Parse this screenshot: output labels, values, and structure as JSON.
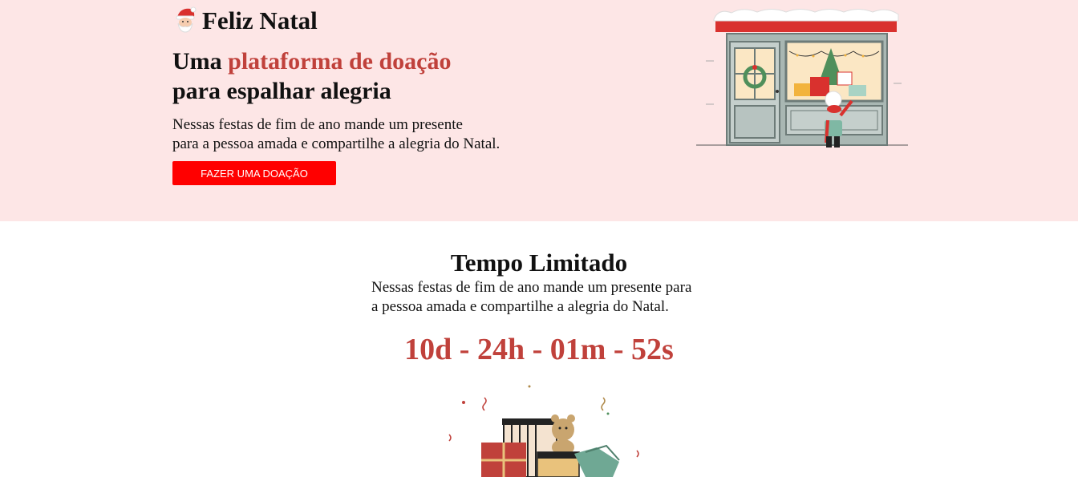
{
  "hero": {
    "brand_title": "Feliz Natal",
    "brand_icon": "santa-icon",
    "headline_part1": "Uma ",
    "headline_accent": "plataforma de doação",
    "headline_line2": "para espalhar alegria",
    "description_line1": "Nessas festas de fim de ano mande um presente",
    "description_line2": "para a pessoa amada e compartilhe a alegria do Natal.",
    "cta_label": "FAZER UMA DOAÇÃO"
  },
  "limited": {
    "title": "Tempo Limitado",
    "description_line1": "Nessas festas de fim de ano mande um presente para",
    "description_line2": "a pessoa amada e compartilhe a alegria do Natal.",
    "countdown": "10d - 24h - 01m - 52s"
  },
  "colors": {
    "hero_background": "#fde6e6",
    "accent": "#c0413b",
    "cta_background": "#ff0000",
    "page_background": "#ffffff"
  }
}
